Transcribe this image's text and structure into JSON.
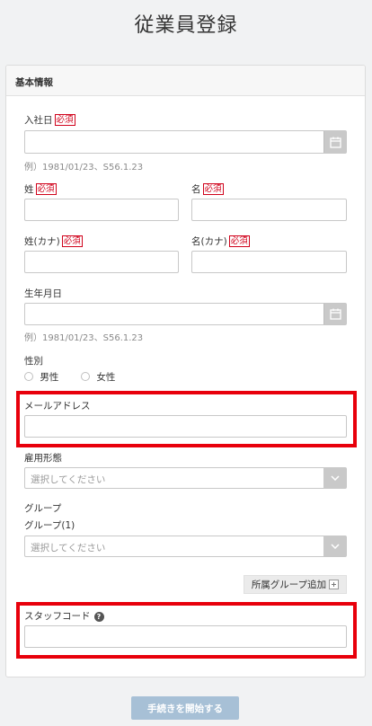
{
  "page": {
    "title": "従業員登録"
  },
  "section": {
    "header": "基本情報"
  },
  "form": {
    "required_badge": "必須",
    "hire_date": {
      "label": "入社日",
      "value": "",
      "hint": "例）1981/01/23、S56.1.23",
      "icon": "calendar-icon"
    },
    "last_name": {
      "label": "姓",
      "value": ""
    },
    "first_name": {
      "label": "名",
      "value": ""
    },
    "last_name_kana": {
      "label": "姓(カナ)",
      "value": ""
    },
    "first_name_kana": {
      "label": "名(カナ)",
      "value": ""
    },
    "birth_date": {
      "label": "生年月日",
      "value": "",
      "hint": "例）1981/01/23、S56.1.23",
      "icon": "calendar-icon"
    },
    "gender": {
      "label": "性別",
      "options": [
        "男性",
        "女性"
      ],
      "selected": null
    },
    "email": {
      "label": "メールアドレス",
      "value": ""
    },
    "employment_type": {
      "label": "雇用形態",
      "placeholder": "選択してください"
    },
    "group": {
      "label": "グループ",
      "sub_label": "グループ(1)",
      "placeholder": "選択してください",
      "add_button": "所属グループ追加"
    },
    "staff_code": {
      "label": "スタッフコード",
      "value": "",
      "help_icon": "?"
    }
  },
  "actions": {
    "submit": "手続きを開始する"
  },
  "colors": {
    "highlight": "#e8000b",
    "required": "#d0021b",
    "submit_bg": "#a7c0d6",
    "addon_bg": "#c9c9c9"
  }
}
